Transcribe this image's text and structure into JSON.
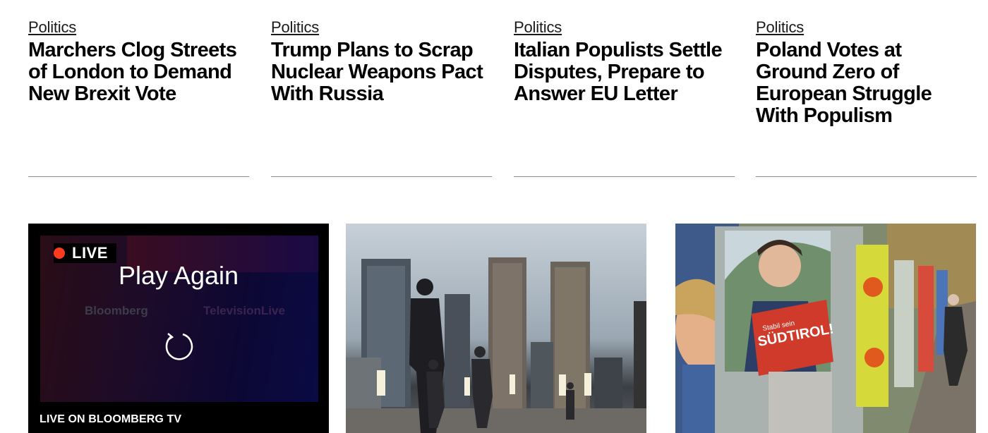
{
  "stories": [
    {
      "category": "Politics",
      "headline": "Marchers Clog Streets of London to Demand New Brexit Vote"
    },
    {
      "category": "Politics",
      "headline": "Trump Plans to Scrap Nuclear Weapons Pact With Russia"
    },
    {
      "category": "Politics",
      "headline": "Italian Populists Settle Disputes, Prepare to Answer EU Letter"
    },
    {
      "category": "Politics",
      "headline": "Poland Votes at Ground Zero of European Struggle With Populism"
    }
  ],
  "live_tile": {
    "badge": "LIVE",
    "play_again": "Play Again",
    "brand_left": "Bloomberg",
    "brand_right": "TelevisionLive",
    "caption": "LIVE ON BLOOMBERG TV",
    "replay_icon": "replay-icon",
    "badge_color": "#ff3b1f"
  },
  "poster_text": {
    "line1": "Stabil sein",
    "line2": "SÜDTIROL!"
  }
}
